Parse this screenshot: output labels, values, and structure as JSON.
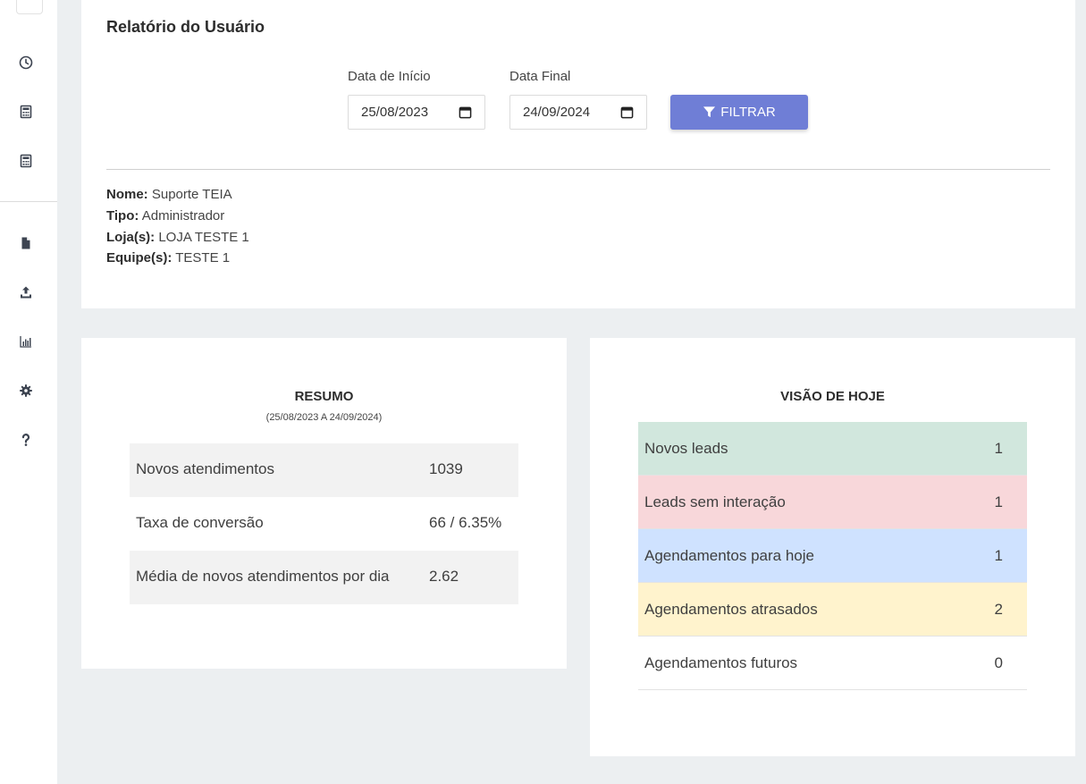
{
  "sidebar": {
    "icons": [
      "search-icon",
      "clock-icon",
      "calculator-icon",
      "calculator-icon",
      "file-icon",
      "upload-icon",
      "bar-chart-icon",
      "gear-icon",
      "question-icon"
    ]
  },
  "report": {
    "title": "Relatório do Usuário",
    "start_label": "Data de Início",
    "start_value": "25/08/2023",
    "end_label": "Data Final",
    "end_value": "24/09/2024",
    "filter_button": "FILTRAR",
    "user": [
      {
        "label": "Nome:",
        "value": "Suporte TEIA"
      },
      {
        "label": "Tipo:",
        "value": "Administrador"
      },
      {
        "label": "Loja(s):",
        "value": "LOJA TESTE 1"
      },
      {
        "label": "Equipe(s):",
        "value": "TESTE 1"
      }
    ]
  },
  "resumo": {
    "title": "RESUMO",
    "period": "(25/08/2023 A 24/09/2024)",
    "rows": [
      {
        "label": "Novos atendimentos",
        "value": "1039"
      },
      {
        "label": "Taxa de conversão",
        "value": "66 / 6.35%"
      },
      {
        "label": "Média de novos atendimentos por dia",
        "value": "2.62"
      }
    ]
  },
  "visao": {
    "title": "VISÃO DE HOJE",
    "rows": [
      {
        "label": "Novos leads",
        "value": "1"
      },
      {
        "label": "Leads sem interação",
        "value": "1"
      },
      {
        "label": "Agendamentos para hoje",
        "value": "1"
      },
      {
        "label": "Agendamentos atrasados",
        "value": "2"
      },
      {
        "label": "Agendamentos futuros",
        "value": "0"
      }
    ]
  },
  "colors": {
    "primary_button": "#6f7ed6",
    "striped_row": "#f2f2f2",
    "row_success": "#d1e7dd",
    "row_danger": "#f8d7da",
    "row_primary": "#cfe2ff",
    "row_warning": "#fff3cd"
  }
}
